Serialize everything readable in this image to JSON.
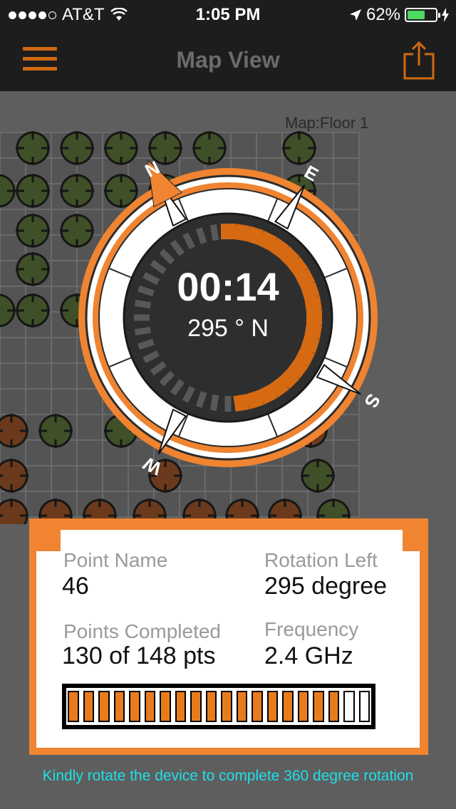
{
  "status_bar": {
    "carrier": "AT&T",
    "time": "1:05 PM",
    "battery_percent": "62%",
    "battery_level": 0.62
  },
  "nav": {
    "title": "Map View",
    "menu_icon": "hamburger-icon",
    "share_icon": "share-icon"
  },
  "map": {
    "label": "Map:Floor 1"
  },
  "compass": {
    "timer": "00:14",
    "heading": "295 ° N",
    "directions": {
      "n": "N",
      "e": "E",
      "s": "S",
      "w": "W"
    },
    "progress_fraction": 0.5,
    "accent_color": "#f08431"
  },
  "info": {
    "point_name_label": "Point Name",
    "point_name_value": "46",
    "rotation_left_label": "Rotation Left",
    "rotation_left_value": "295 degree",
    "points_completed_label": "Points Completed",
    "points_completed_value": "130 of 148 pts",
    "frequency_label": "Frequency",
    "frequency_value": "2.4 GHz",
    "progress": {
      "completed": 130,
      "total": 148,
      "fraction": 0.878
    }
  },
  "hint": "Kindly rotate the device to complete 360 degree rotation"
}
